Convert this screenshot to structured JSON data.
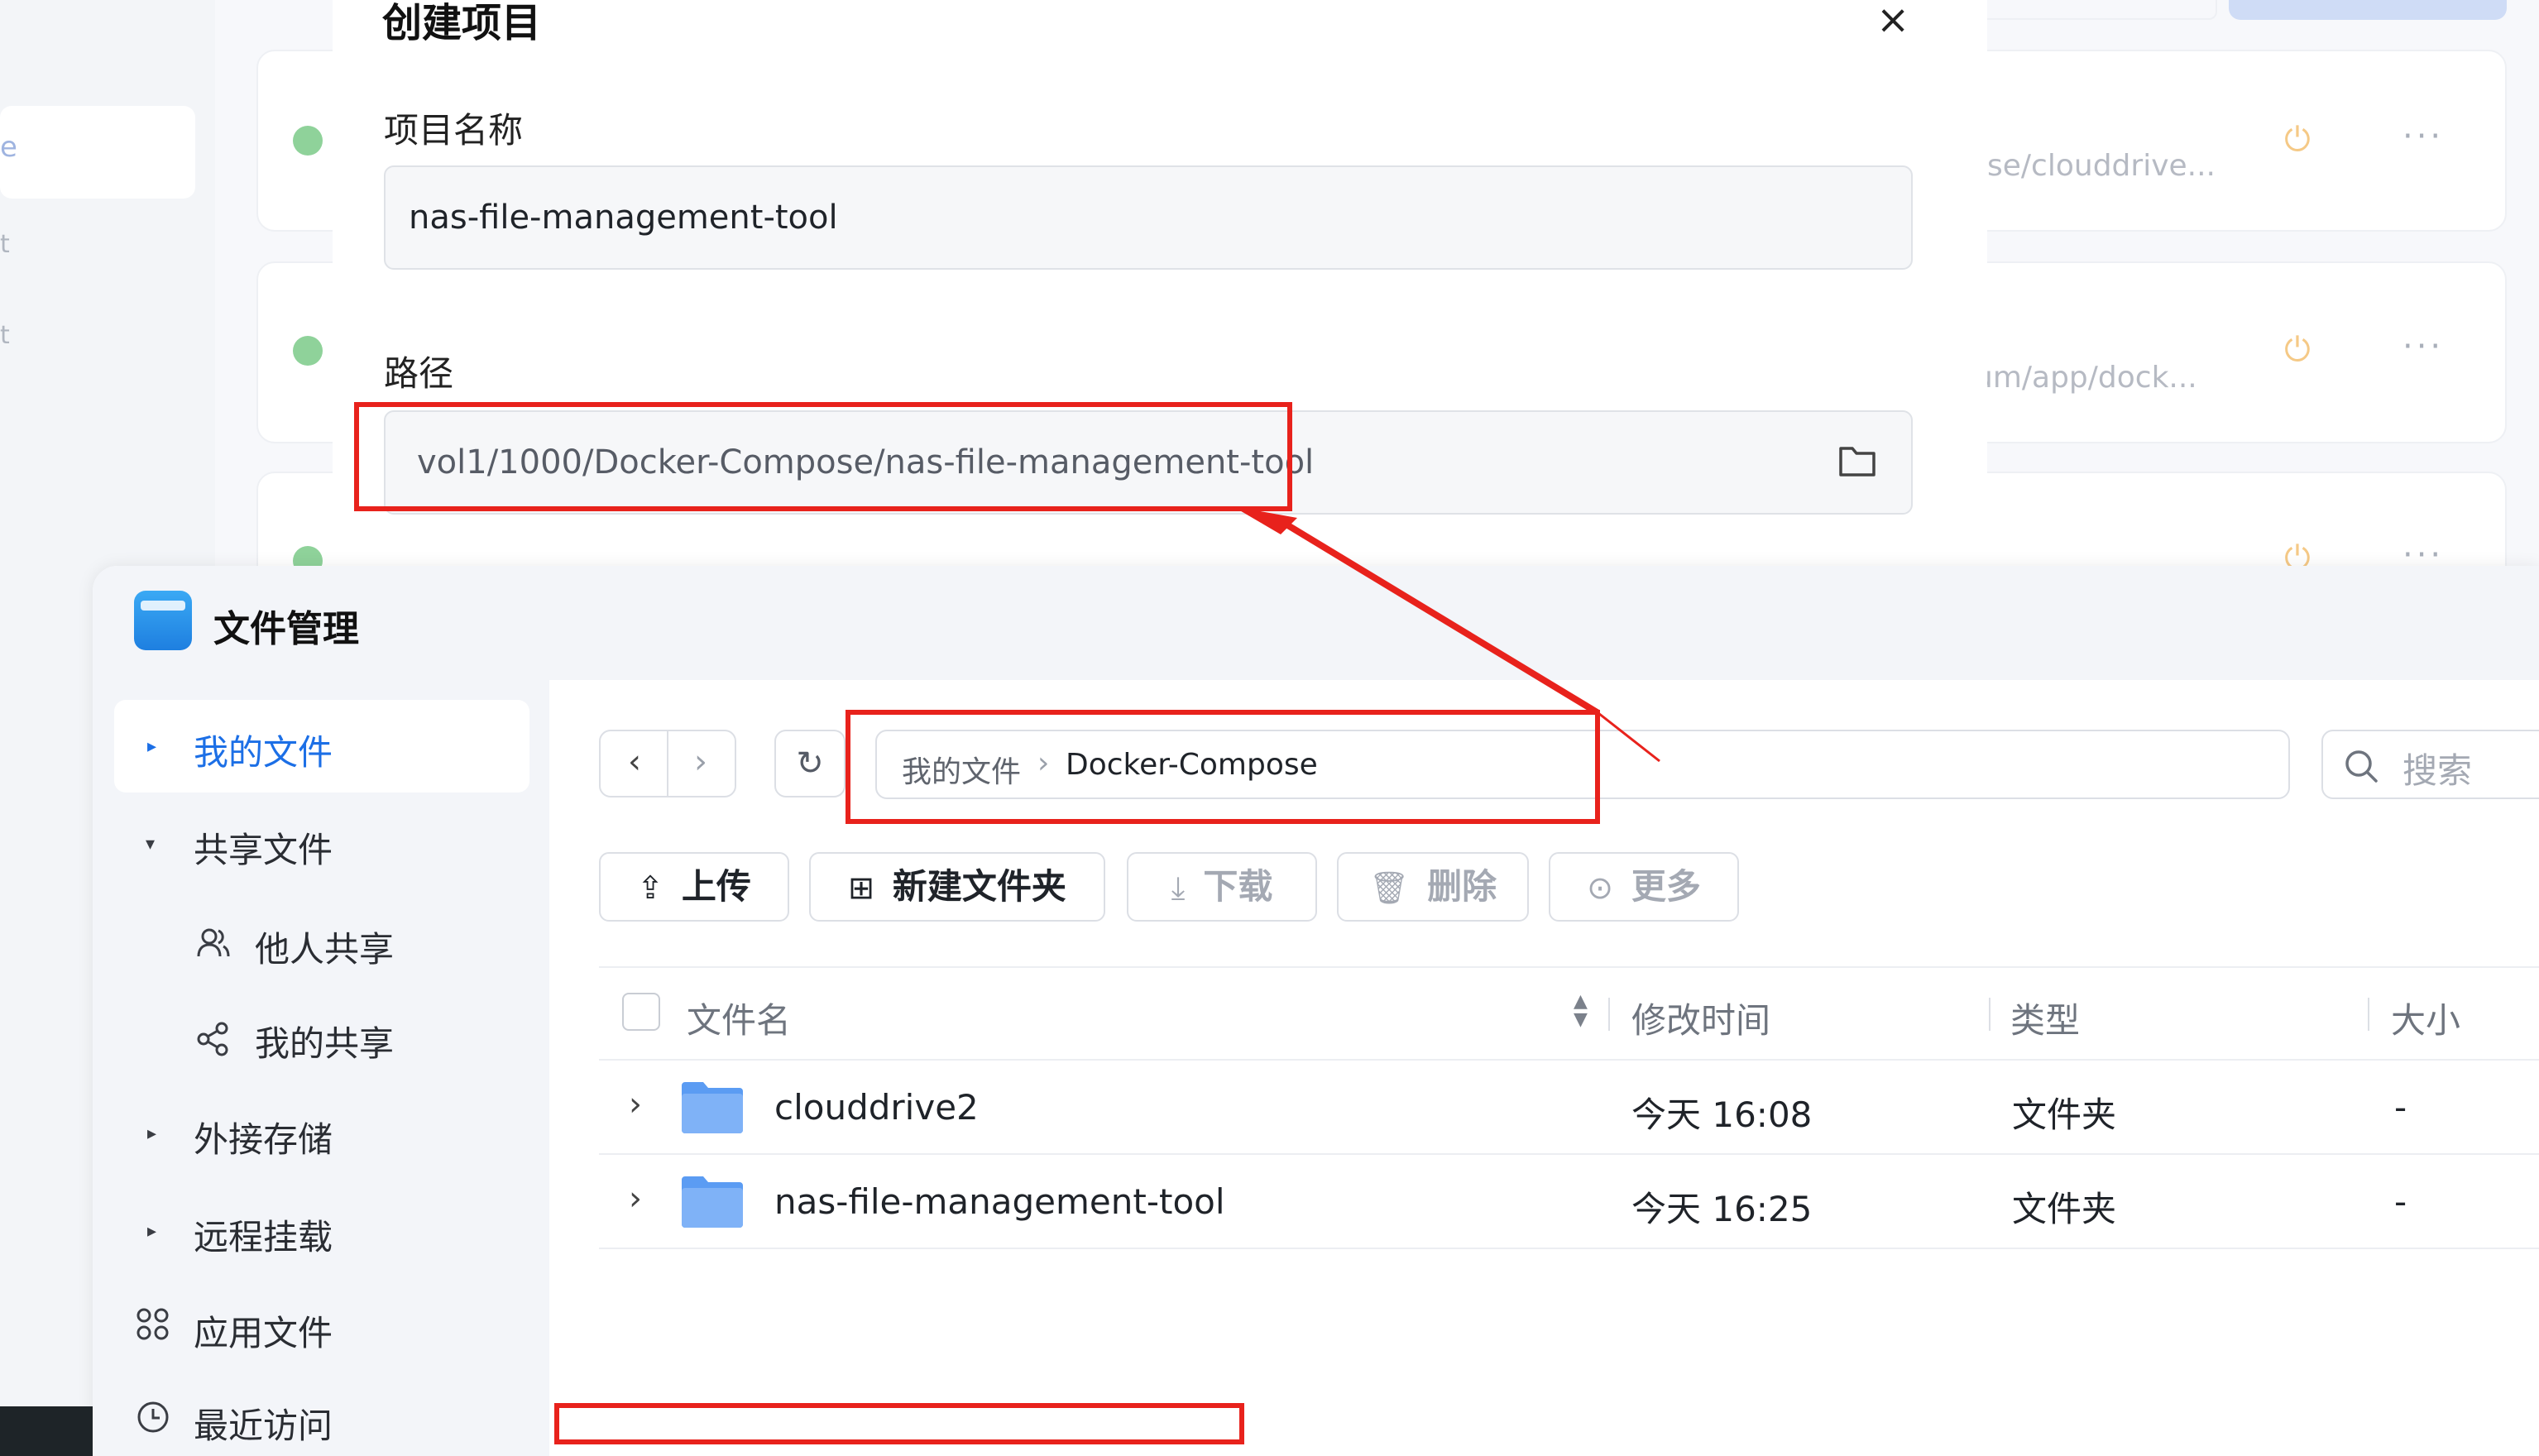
{
  "background_app": {
    "left_items": [
      "e",
      "t",
      "t"
    ],
    "rows": [
      {
        "path": "ose/clouddrive..."
      },
      {
        "path": "um/app/dock..."
      },
      {
        "path": ""
      }
    ],
    "more_label": "···",
    "colors": {
      "status_green": "#8fd29a",
      "power": "#f5c986"
    }
  },
  "dialog": {
    "title": "创建项目",
    "close_label": "×",
    "name_label": "项目名称",
    "name_value": "nas-file-management-tool",
    "path_label": "路径",
    "path_value": "vol1/1000/Docker-Compose/nas-file-management-tool",
    "browse_icon": "folder-icon"
  },
  "file_manager": {
    "title": "文件管理",
    "sidebar": [
      {
        "label": "我的文件",
        "icon": "caret-right",
        "active": true
      },
      {
        "label": "共享文件",
        "icon": "caret-down"
      },
      {
        "label": "他人共享",
        "icon": "users-icon"
      },
      {
        "label": "我的共享",
        "icon": "share-icon"
      },
      {
        "label": "外接存储",
        "icon": "caret-right"
      },
      {
        "label": "远程挂载",
        "icon": "caret-right"
      },
      {
        "label": "应用文件",
        "icon": "apps-icon"
      },
      {
        "label": "最近访问",
        "icon": "clock-icon"
      }
    ],
    "nav": {
      "back": "‹",
      "forward": "›",
      "refresh": "↻"
    },
    "breadcrumb": [
      "我的文件",
      "Docker-Compose"
    ],
    "breadcrumb_sep": "›",
    "search_placeholder": "搜索",
    "toolbar": {
      "upload": "上传",
      "new_folder": "新建文件夹",
      "download": "下载",
      "delete": "删除",
      "more": "更多"
    },
    "columns": {
      "name": "文件名",
      "modified": "修改时间",
      "type": "类型",
      "size": "大小"
    },
    "rows": [
      {
        "name": "clouddrive2",
        "modified": "今天 16:08",
        "type": "文件夹",
        "size": "-"
      },
      {
        "name": "nas-file-management-tool",
        "modified": "今天 16:25",
        "type": "文件夹",
        "size": "-"
      }
    ],
    "colors": {
      "accent": "#1c6fe6",
      "folder": "#5b9cf3"
    }
  },
  "annotation": {
    "color": "#e8221c"
  }
}
